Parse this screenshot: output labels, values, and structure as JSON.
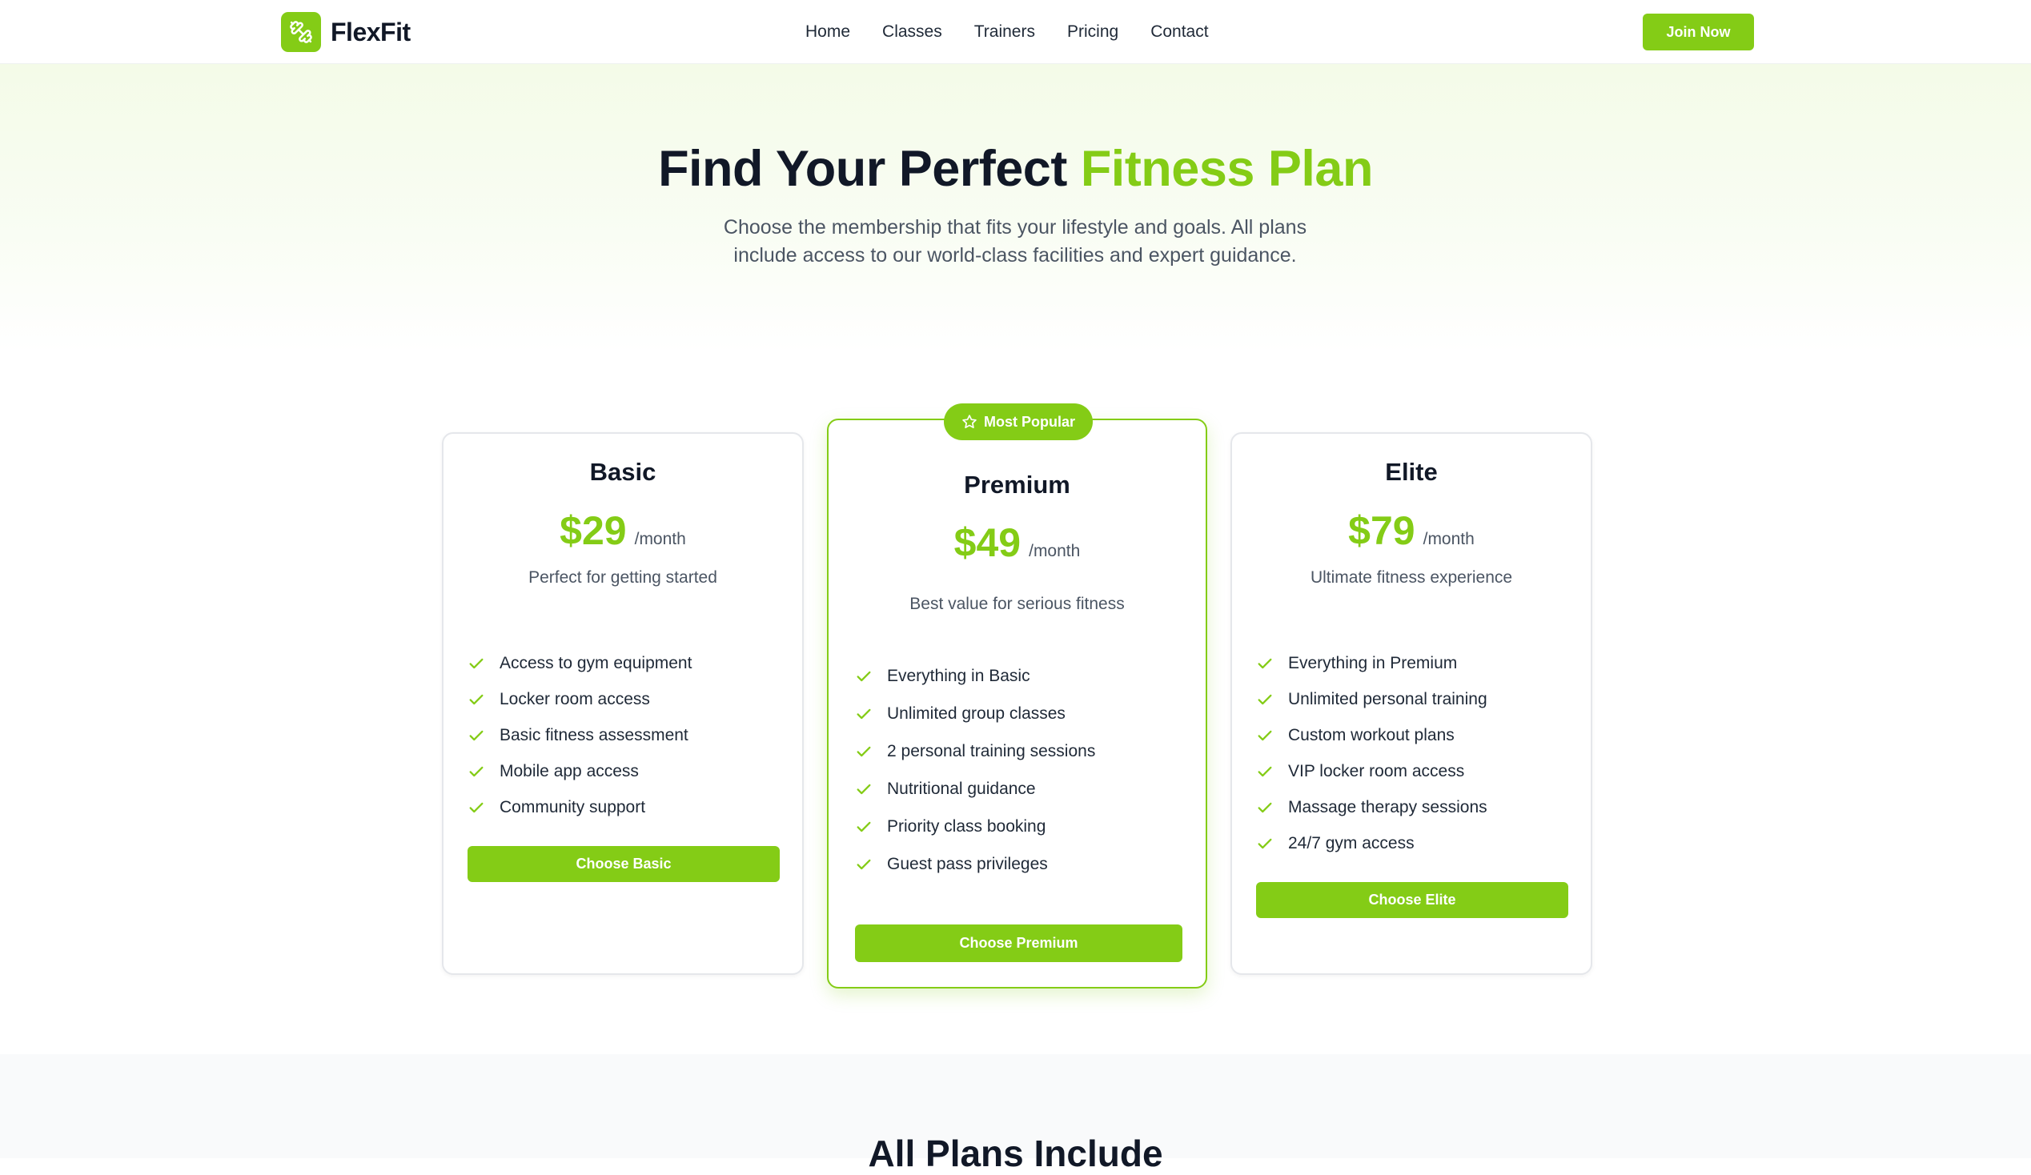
{
  "brand": {
    "name": "FlexFit",
    "logo_icon": "dumbbell-icon",
    "accent_color": "#84cc16"
  },
  "nav": {
    "links": [
      "Home",
      "Classes",
      "Trainers",
      "Pricing",
      "Contact"
    ],
    "cta": "Join Now"
  },
  "hero": {
    "title_main": "Find Your Perfect ",
    "title_accent": "Fitness Plan",
    "subtitle": "Choose the membership that fits your lifestyle and goals. All plans include access to our world-class facilities and expert guidance."
  },
  "plans": [
    {
      "name": "Basic",
      "price": "$29",
      "period": "/month",
      "tagline": "Perfect for getting started",
      "features": [
        "Access to gym equipment",
        "Locker room access",
        "Basic fitness assessment",
        "Mobile app access",
        "Community support"
      ],
      "button": "Choose Basic"
    },
    {
      "name": "Premium",
      "price": "$49",
      "period": "/month",
      "tagline": "Best value for serious fitness",
      "badge": "Most Popular",
      "badge_icon": "star-icon",
      "features": [
        "Everything in Basic",
        "Unlimited group classes",
        "2 personal training sessions",
        "Nutritional guidance",
        "Priority class booking",
        "Guest pass privileges"
      ],
      "button": "Choose Premium"
    },
    {
      "name": "Elite",
      "price": "$79",
      "period": "/month",
      "tagline": "Ultimate fitness experience",
      "features": [
        "Everything in Premium",
        "Unlimited personal training",
        "Custom workout plans",
        "VIP locker room access",
        "Massage therapy sessions",
        "24/7 gym access"
      ],
      "button": "Choose Elite"
    }
  ],
  "includes": {
    "title": "All Plans Include"
  }
}
